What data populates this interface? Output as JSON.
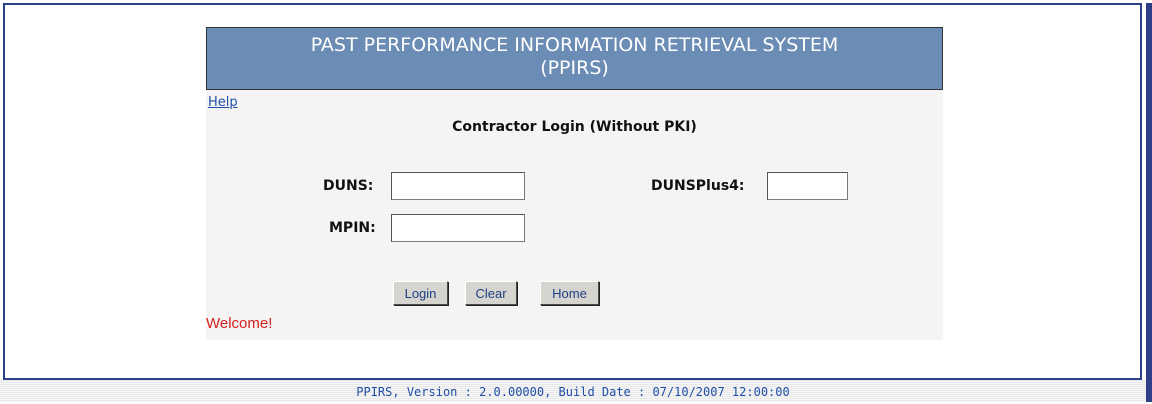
{
  "banner": {
    "title_line1": "PAST PERFORMANCE INFORMATION RETRIEVAL SYSTEM",
    "title_line2": "(PPIRS)"
  },
  "help_label": "Help",
  "form": {
    "title": "Contractor Login (Without PKI)",
    "duns_label": "DUNS:",
    "duns_value": "",
    "dunsplus4_label": "DUNSPlus4:",
    "dunsplus4_value": "",
    "mpin_label": "MPIN:",
    "mpin_value": ""
  },
  "buttons": {
    "login": "Login",
    "clear": "Clear",
    "home": "Home"
  },
  "status_message": "Welcome!",
  "footer_text": "PPIRS, Version : 2.0.00000, Build Date : 07/10/2007 12:00:00",
  "colors": {
    "banner_bg": "#6b8cb4",
    "frame_border": "#2d3f86",
    "link": "#1f4fa8",
    "welcome": "#d42020"
  }
}
